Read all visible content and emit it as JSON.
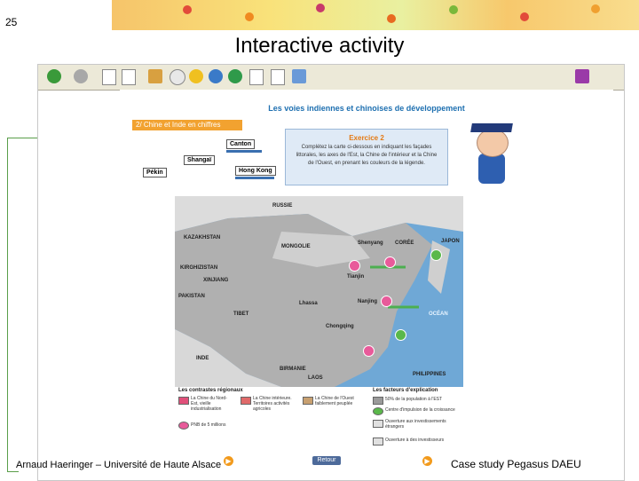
{
  "slide": {
    "number": "25",
    "title": "Interactive activity",
    "footer_left": "Arnaud Haeringer – Université de Haute Alsace",
    "footer_right": "Case study Pegasus DAEU"
  },
  "page": {
    "heading": "Les voies indiennes et chinoises de développement",
    "section_tab": "2/ Chine et Inde en chiffres",
    "cities": [
      "Canton",
      "Shangaï",
      "Hong Kong",
      "Pékin"
    ],
    "exercise": {
      "title": "Exercice 2",
      "text": "Complétez la carte ci-dessous en indiquant les façades littorales, les axes de l'Est, la Chine de l'intérieur et la Chine de l'Ouest, en prenant les couleurs de la légende."
    },
    "map_labels": {
      "russie": "RUSSIE",
      "kazakhstan": "KAZAKHSTAN",
      "mongolie": "MONGOLIE",
      "kirghizistan": "KIRGHIZISTAN",
      "xinjiang": "XINJIANG",
      "pakistan": "PAKISTAN",
      "tibet": "TIBET",
      "inde": "INDE",
      "birmanie": "BIRMANIE",
      "laos": "LAOS",
      "philippines": "PHILIPPINES",
      "coree": "CORÉE",
      "japon": "JAPON",
      "shenyang": "Shenyang",
      "tianjin": "Tianjin",
      "lhassa": "Lhassa",
      "nanjing": "Nanjing",
      "chongqing": "Chongqing",
      "ocean": "OCÉAN"
    },
    "legend": {
      "left_title": "Les contrastes régionaux",
      "right_title": "Les facteurs d'explication",
      "left_items": [
        "La Chine du Nord-Est, vieille industrialisation",
        "La Chine intérieure. Territoires activités agricoles",
        "La Chine de l'Ouest faiblement peuplée",
        "PNB de 5 millions"
      ],
      "right_items": [
        "50% de la population à l'EST",
        "Centre d'impulsion de la croissance",
        "Ouverture aux investissements étrangers",
        "Ouverture à des investisseurs"
      ],
      "colors": {
        "pink": "#e0507a",
        "red": "#e06a6a",
        "tan": "#c8a070",
        "green": "#3fa83a"
      }
    },
    "retour_label": "Retour"
  }
}
